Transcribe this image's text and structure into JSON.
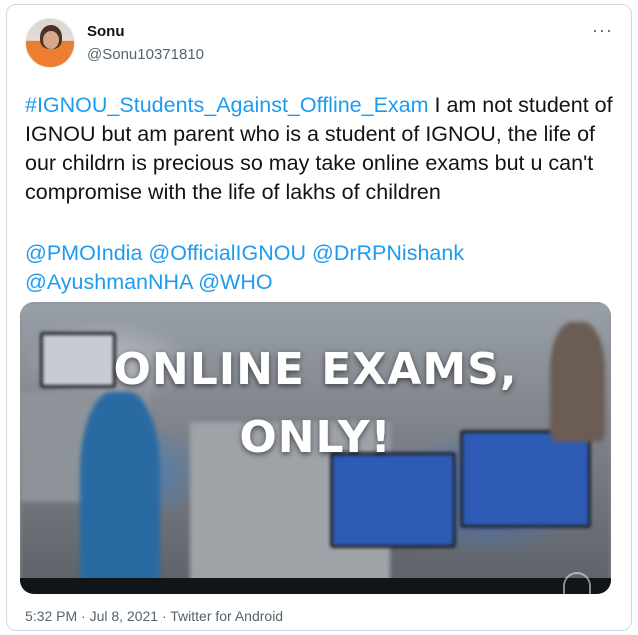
{
  "author": {
    "display_name": "Sonu",
    "handle": "@Sonu10371810"
  },
  "more_menu": "···",
  "tweet": {
    "hashtag": "#IGNOU_Students_Against_Offline_Exam",
    "body": " I am not student of IGNOU but am parent who is a student of IGNOU, the life of our childrn is precious so may take online exams but u can't compromise with the life of lakhs of children",
    "mentions": [
      "@PMOIndia",
      "@OfficialIGNOU",
      "@DrRPNishank",
      "@AyushmanNHA",
      "@WHO"
    ]
  },
  "media": {
    "caption_line1": "ONLINE EXAMS,",
    "caption_line2": "ONLY!"
  },
  "footer": {
    "meta": "5:32 PM · Jul 8, 2021 · Twitter for Android"
  },
  "icons": [
    "more-icon",
    "avatar-image"
  ]
}
